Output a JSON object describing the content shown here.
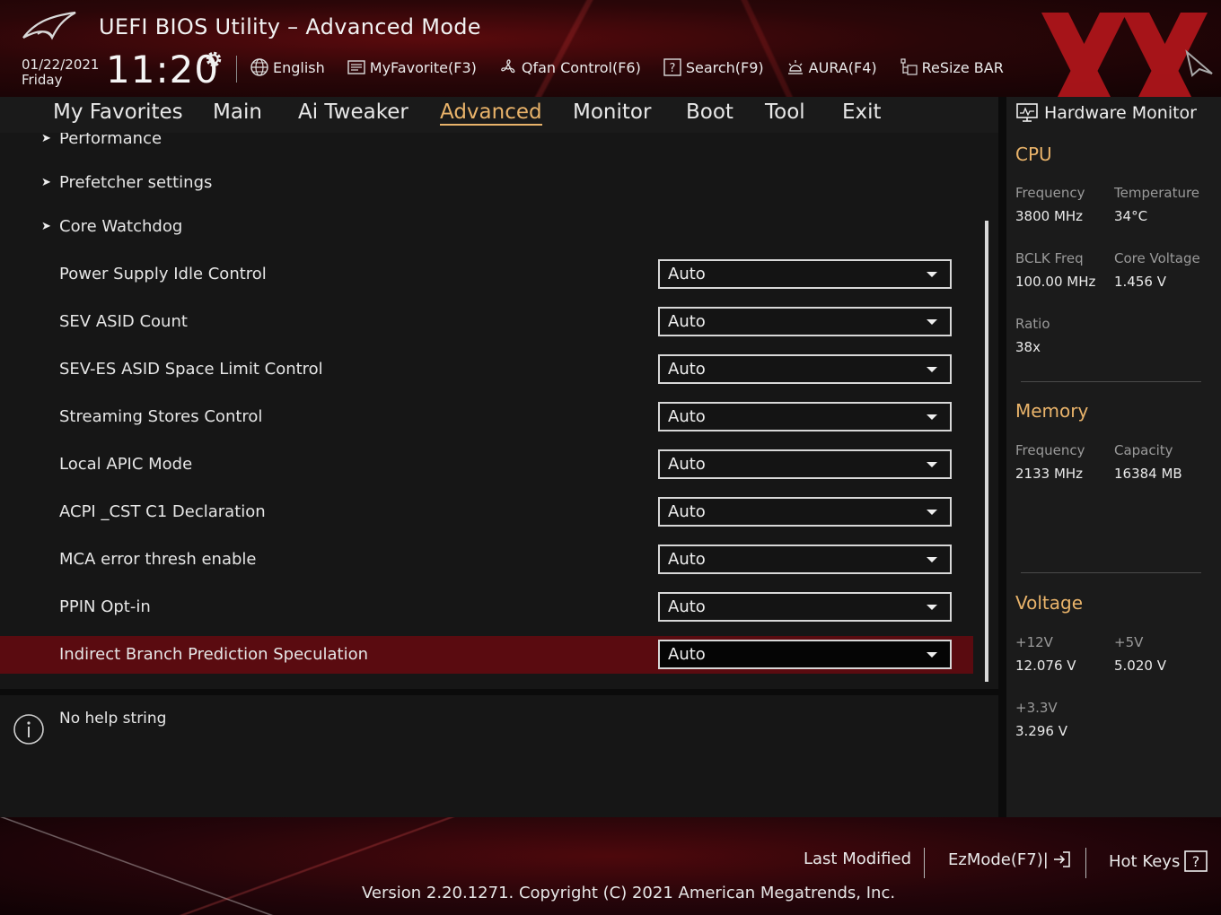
{
  "header": {
    "title": "UEFI BIOS Utility – Advanced Mode",
    "date": "01/22/2021",
    "day": "Friday",
    "time": "11:20",
    "tools": [
      {
        "icon": "globe-icon",
        "label": "English"
      },
      {
        "icon": "my-favorite-icon",
        "label": "MyFavorite(F3)"
      },
      {
        "icon": "fan-icon",
        "label": "Qfan Control(F6)"
      },
      {
        "icon": "search-help-icon",
        "label": "Search(F9)"
      },
      {
        "icon": "aura-light-icon",
        "label": "AURA(F4)"
      },
      {
        "icon": "resize-bar-icon",
        "label": "ReSize BAR"
      }
    ]
  },
  "tabs": [
    {
      "label": "My Favorites"
    },
    {
      "label": "Main"
    },
    {
      "label": "Ai Tweaker"
    },
    {
      "label": "Advanced",
      "active": true
    },
    {
      "label": "Monitor"
    },
    {
      "label": "Boot"
    },
    {
      "label": "Tool"
    },
    {
      "label": "Exit"
    }
  ],
  "settings": {
    "submenus": [
      {
        "label": "Performance"
      },
      {
        "label": "Prefetcher settings"
      },
      {
        "label": "Core Watchdog"
      }
    ],
    "options": [
      {
        "label": "Power Supply Idle Control",
        "value": "Auto"
      },
      {
        "label": "SEV ASID Count",
        "value": "Auto"
      },
      {
        "label": "SEV-ES ASID Space Limit Control",
        "value": "Auto"
      },
      {
        "label": "Streaming Stores Control",
        "value": "Auto"
      },
      {
        "label": "Local APIC Mode",
        "value": "Auto"
      },
      {
        "label": "ACPI _CST C1 Declaration",
        "value": "Auto"
      },
      {
        "label": "MCA error thresh enable",
        "value": "Auto"
      },
      {
        "label": "PPIN Opt-in",
        "value": "Auto"
      },
      {
        "label": "Indirect Branch Prediction Speculation",
        "value": "Auto",
        "selected": true
      }
    ]
  },
  "help": {
    "text": "No help string"
  },
  "hardware_monitor": {
    "title": "Hardware Monitor",
    "cpu": {
      "heading": "CPU",
      "frequency_label": "Frequency",
      "frequency": "3800 MHz",
      "temperature_label": "Temperature",
      "temperature": "34°C",
      "bclk_label": "BCLK Freq",
      "bclk": "100.00 MHz",
      "core_voltage_label": "Core Voltage",
      "core_voltage": "1.456 V",
      "ratio_label": "Ratio",
      "ratio": "38x"
    },
    "memory": {
      "heading": "Memory",
      "frequency_label": "Frequency",
      "frequency": "2133 MHz",
      "capacity_label": "Capacity",
      "capacity": "16384 MB"
    },
    "voltage": {
      "heading": "Voltage",
      "v12_label": "+12V",
      "v12": "12.076 V",
      "v5_label": "+5V",
      "v5": "5.020 V",
      "v33_label": "+3.3V",
      "v33": "3.296 V"
    }
  },
  "footer": {
    "last_modified": "Last Modified",
    "ezmode": "EzMode(F7)|",
    "hot_keys": "Hot Keys",
    "version": "Version 2.20.1271. Copyright (C) 2021 American Megatrends, Inc."
  },
  "colors": {
    "accent": "#e9b36a",
    "selected_row": "#5a0b10",
    "panel": "#161616",
    "header_red": "#5a0a0d"
  }
}
